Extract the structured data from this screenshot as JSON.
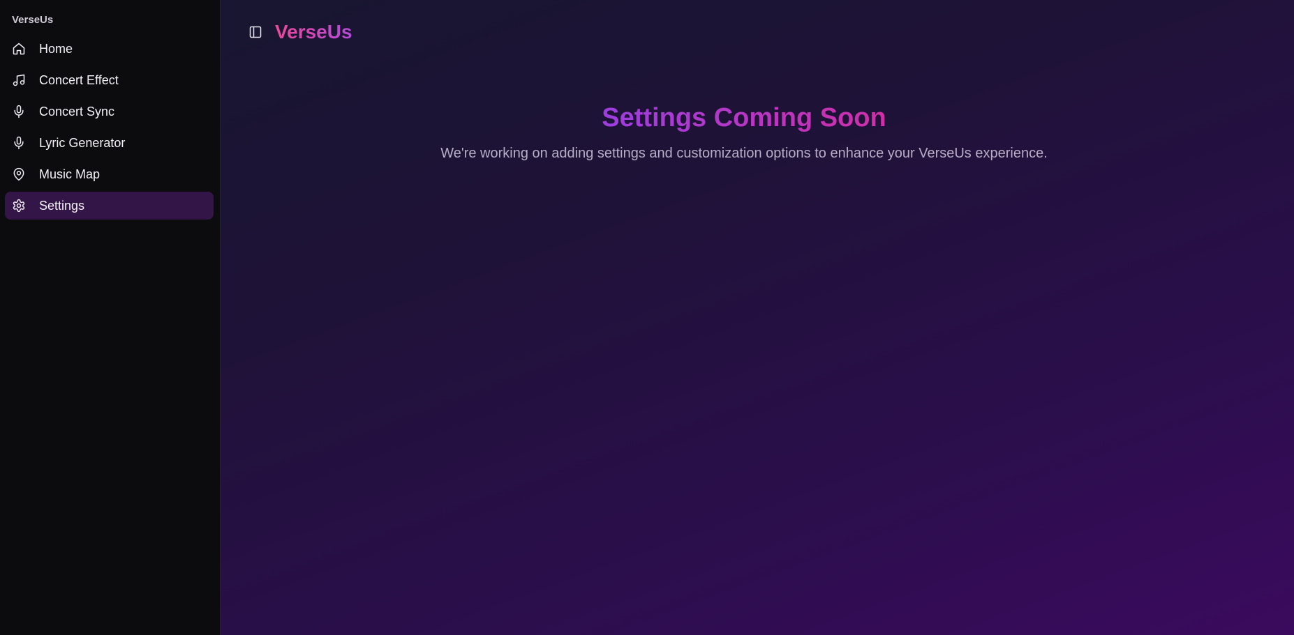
{
  "sidebar": {
    "brand": "VerseUs",
    "items": [
      {
        "label": "Home",
        "icon": "home-icon",
        "active": false
      },
      {
        "label": "Concert Effect",
        "icon": "music-note-icon",
        "active": false
      },
      {
        "label": "Concert Sync",
        "icon": "microphone-icon",
        "active": false
      },
      {
        "label": "Lyric Generator",
        "icon": "microphone-icon",
        "active": false
      },
      {
        "label": "Music Map",
        "icon": "map-pin-icon",
        "active": false
      },
      {
        "label": "Settings",
        "icon": "gear-icon",
        "active": true
      }
    ]
  },
  "header": {
    "toggle_icon": "sidebar-toggle-icon",
    "title": "VerseUs"
  },
  "main": {
    "heading": "Settings Coming Soon",
    "description": "We're working on adding settings and customization options to enhance your VerseUs experience."
  },
  "colors": {
    "accent_pink": "#ec4899",
    "accent_purple": "#a83ee0",
    "active_item_bg": "#331548",
    "sidebar_bg": "#0c0b0e"
  }
}
